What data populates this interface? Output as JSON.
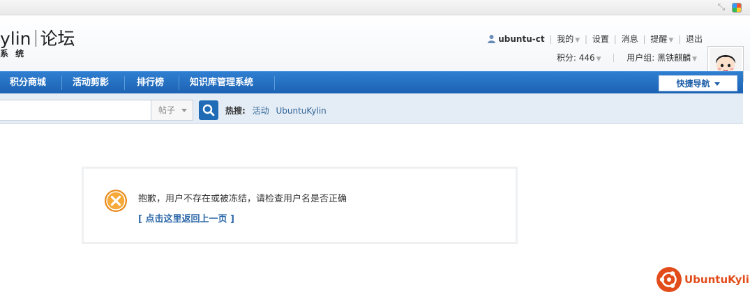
{
  "browser": {
    "icons": [
      "shrink-arrows-icon",
      "color-picker-icon"
    ]
  },
  "header": {
    "logo_left": "ylin",
    "logo_right": "论坛",
    "logo_sub": "系 统"
  },
  "userbar": {
    "username": "ubuntu-ct",
    "links": [
      "我的",
      "设置",
      "消息",
      "提醒",
      "退出"
    ],
    "points": "积分: 446",
    "user_group": "用户组: 黑铁麒麟"
  },
  "nav": {
    "items": [
      "积分商城",
      "活动剪影",
      "排行榜",
      "知识库管理系统"
    ],
    "quick_nav": "快捷导航"
  },
  "search": {
    "input_value": "",
    "type": "帖子",
    "hot_label": "热搜:",
    "hot_links": [
      "活动",
      "UbuntuKylin"
    ]
  },
  "message": {
    "text": "抱歉，用户不存在或被冻结，请检查用户名是否正确",
    "back_link": "[ 点击这里返回上一页 ]"
  },
  "footer": {
    "brand": "UbuntuKylin"
  },
  "colors": {
    "nav_blue": "#1c62b3",
    "accent_orange": "#f0962a",
    "brand_orange": "#e24c1a"
  }
}
